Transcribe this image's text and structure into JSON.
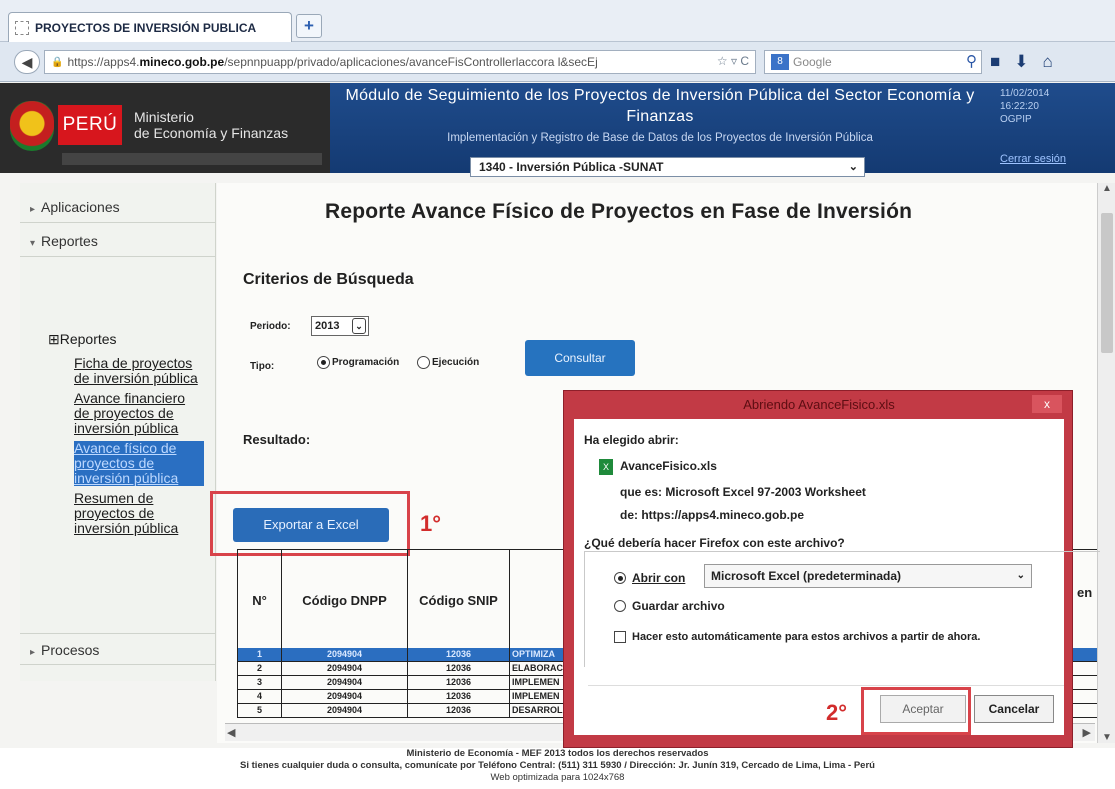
{
  "browser": {
    "tab_title": "PROYECTOS DE INVERSIÓN PUBLICA",
    "new_tab": "+",
    "url_prefix": "https://apps4.",
    "url_domain": "mineco.gob.pe",
    "url_path": "/sepnnpuapp/privado/aplicaciones/avanceFisControllerlaccora l&secEj",
    "url_end": "☆ ▿ C",
    "search_engine": "Google",
    "search_placeholder": "Google"
  },
  "header": {
    "brand": "PERÚ",
    "ministry_line1": "Ministerio",
    "ministry_line2": "de Economía y Finanzas",
    "module_title": "Módulo de Seguimiento de los Proyectos de Inversión Pública del Sector Economía y Finanzas",
    "module_subtitle": "Implementación y Registro de Base de Datos de los Proyectos de Inversión Pública",
    "unit_selected": "1340 - Inversión Pública -SUNAT",
    "date": "11/02/2014",
    "time": "16:22:20",
    "office": "OGPIP",
    "logout": "Cerrar sesión"
  },
  "sidebar": {
    "aplicaciones": "Aplicaciones",
    "reportes": "Reportes",
    "reportes_sub": "Reportes",
    "links": [
      "Ficha de proyectos de inversión pública",
      "Avance financiero de proyectos de inversión pública",
      "Avance físico de proyectos de inversión pública",
      "Resumen de proyectos de inversión pública"
    ],
    "procesos": "Procesos"
  },
  "main": {
    "title": "Reporte Avance Físico de Proyectos en Fase de Inversión",
    "criteria_title": "Criterios de Búsqueda",
    "periodo_label": "Periodo:",
    "periodo_value": "2013",
    "tipo_label": "Tipo:",
    "tipo_programacion": "Programación",
    "tipo_ejecucion": "Ejecución",
    "consultar": "Consultar",
    "resultado": "Resultado:",
    "export_button": "Exportar a Excel",
    "step1": "1°",
    "table_headers": [
      "N°",
      "Código DNPP",
      "Código SNIP"
    ],
    "right_fragment": "en",
    "rows": [
      {
        "n": "1",
        "dnpp": "2094904",
        "snip": "12036",
        "desc": "OPTIMIZA"
      },
      {
        "n": "2",
        "dnpp": "2094904",
        "snip": "12036",
        "desc": "ELABORAC"
      },
      {
        "n": "3",
        "dnpp": "2094904",
        "snip": "12036",
        "desc": "IMPLEMEN"
      },
      {
        "n": "4",
        "dnpp": "2094904",
        "snip": "12036",
        "desc": "IMPLEMEN"
      },
      {
        "n": "5",
        "dnpp": "2094904",
        "snip": "12036",
        "desc": "DESARROL"
      }
    ]
  },
  "dialog": {
    "title": "Abriendo AvanceFisico.xls",
    "close": "x",
    "chosen_label": "Ha elegido abrir:",
    "file_name": "AvanceFisico.xls",
    "file_type": "que es:  Microsoft Excel 97-2003 Worksheet",
    "file_source": "de:  https://apps4.mineco.gob.pe",
    "question": "¿Qué debería hacer Firefox con este archivo?",
    "open_with_label": "Abrir con",
    "open_with_app": "Microsoft Excel (predeterminada)",
    "save_file_label": "Guardar archivo",
    "auto_label": "Hacer esto automáticamente para estos archivos a partir de ahora.",
    "accept": "Aceptar",
    "cancel": "Cancelar",
    "step2": "2°"
  },
  "footer": {
    "line1": "Ministerio de Economía - MEF 2013 todos los derechos reservados",
    "line2": "Si tienes cualquier duda o consulta, comunícate por Teléfono Central: (511) 311 5930 / Dirección: Jr. Junín 319, Cercado de Lima, Lima - Perú",
    "line3": "Web optimizada para 1024x768"
  }
}
